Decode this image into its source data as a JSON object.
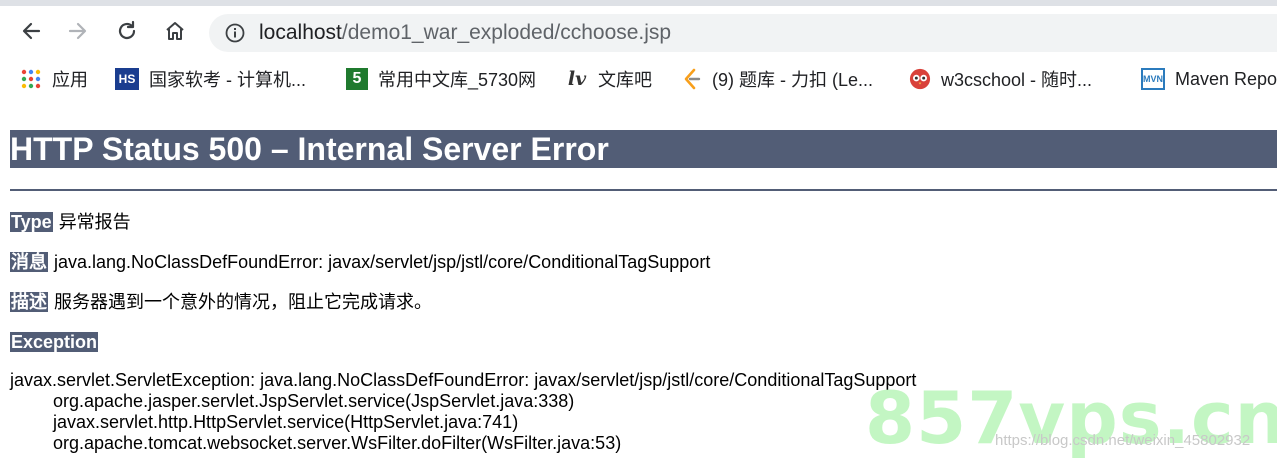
{
  "browser": {
    "url_host": "localhost",
    "url_path": "/demo1_war_exploded/cchoose.jsp"
  },
  "bookmarks": [
    {
      "label": "应用",
      "icon": "apps-grid-icon"
    },
    {
      "label": "国家软考 - 计算机...",
      "icon": "hs-logo-icon"
    },
    {
      "label": "常用中文库_5730网",
      "icon": "number-5-icon"
    },
    {
      "label": "文库吧",
      "icon": "wenku-logo-icon"
    },
    {
      "label": "(9) 题库 - 力扣 (Le...",
      "icon": "leetcode-icon"
    },
    {
      "label": "w3cschool - 随时...",
      "icon": "owl-icon"
    },
    {
      "label": "Maven Repo",
      "icon": "mvn-icon"
    }
  ],
  "page": {
    "title": "HTTP Status 500 – Internal Server Error",
    "type_label": "Type",
    "type_value": "异常报告",
    "message_label": "消息",
    "message_value": "java.lang.NoClassDefFoundError: javax/servlet/jsp/jstl/core/ConditionalTagSupport",
    "description_label": "描述",
    "description_value": "服务器遇到一个意外的情况，阻止它完成请求。",
    "exception_label": "Exception",
    "stack": [
      "javax.servlet.ServletException: java.lang.NoClassDefFoundError: javax/servlet/jsp/jstl/core/ConditionalTagSupport",
      "org.apache.jasper.servlet.JspServlet.service(JspServlet.java:338)",
      "javax.servlet.http.HttpServlet.service(HttpServlet.java:741)",
      "org.apache.tomcat.websocket.server.WsFilter.doFilter(WsFilter.java:53)"
    ]
  },
  "watermark": {
    "big": "857vps.cn",
    "small": "https://blog.csdn.net/weixin_45802932"
  },
  "colors": {
    "error_header": "#525d76",
    "watermark": "#b9f5b9"
  }
}
